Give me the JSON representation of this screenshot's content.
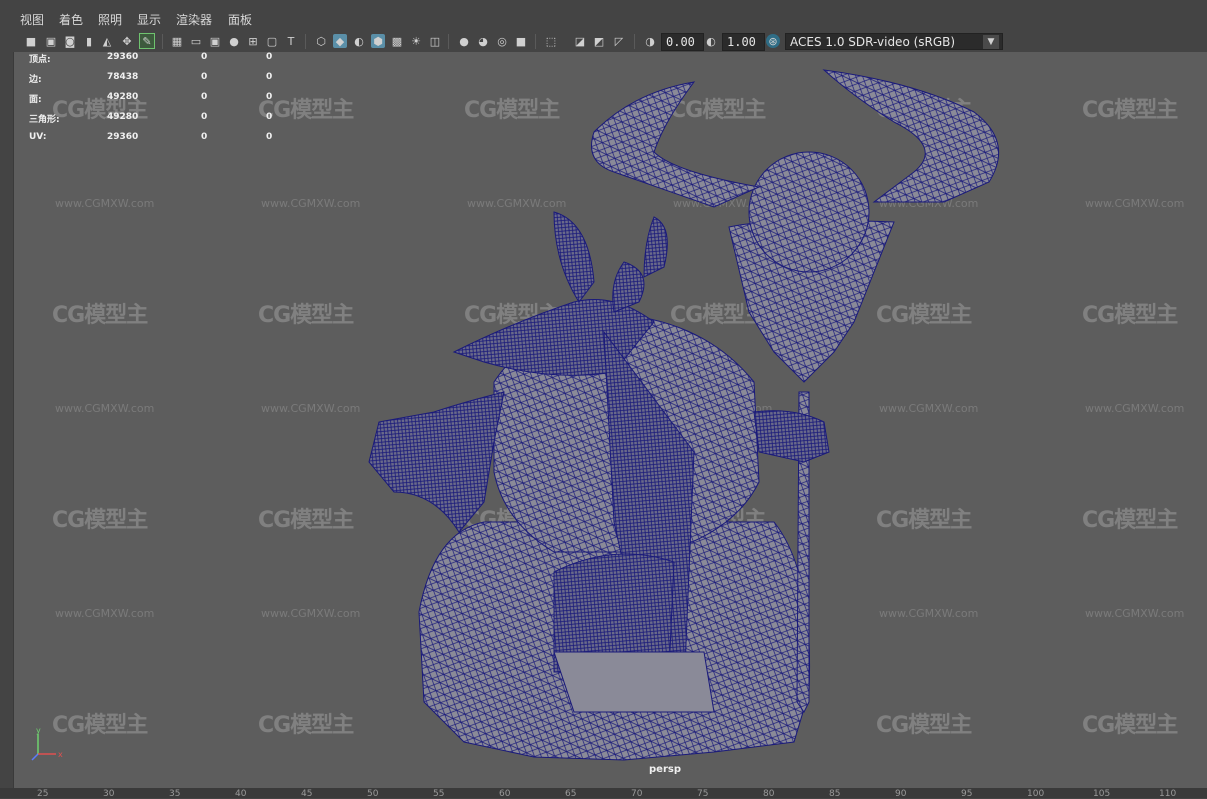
{
  "menu": [
    "视图",
    "着色",
    "照明",
    "显示",
    "渲染器",
    "面板"
  ],
  "toolbar": {
    "exposure_value": "0.00",
    "gamma_value": "1.00",
    "color_space": "ACES 1.0 SDR-video (sRGB)",
    "icons": [
      "select-camera-icon",
      "camera-attrs-icon",
      "bookmark-icon",
      "image-plane-icon",
      "2d-pan-icon",
      "grease-pencil-icon",
      "grid-icon",
      "film-gate-icon",
      "resolution-gate-icon",
      "gate-mask-icon",
      "field-chart-icon",
      "safe-action-icon",
      "safe-title-icon",
      "wireframe-icon",
      "smooth-shade-icon",
      "flat-shade-icon",
      "wireframe-on-shaded-icon",
      "textured-icon",
      "lighting-icon",
      "shadows-icon",
      "ambient-occlusion-icon",
      "motion-blur-icon",
      "anti-alias-icon",
      "depth-of-field-icon",
      "isolate-select-icon",
      "xray-icon",
      "xray-joints-icon",
      "backface-icon",
      "exposure-icon",
      "gamma-icon",
      "color-management-icon"
    ]
  },
  "hud": {
    "rows": [
      {
        "label": "顶点:",
        "total": "29360",
        "selected": "0",
        "uv": "0"
      },
      {
        "label": "边:",
        "total": "78438",
        "selected": "0",
        "uv": "0"
      },
      {
        "label": "面:",
        "total": "49280",
        "selected": "0",
        "uv": "0"
      },
      {
        "label": "三角形:",
        "total": "49280",
        "selected": "0",
        "uv": "0"
      },
      {
        "label": "UV:",
        "total": "29360",
        "selected": "0",
        "uv": "0"
      }
    ]
  },
  "watermark": {
    "logo": "CG模型主",
    "url": "www.CGMXW.com"
  },
  "camera_label": "persp",
  "axis": {
    "y": "y",
    "x": "x",
    "z": "z"
  },
  "ruler": [
    "25",
    "30",
    "35",
    "40",
    "45",
    "50",
    "55",
    "60",
    "65",
    "70",
    "75",
    "80",
    "85",
    "90",
    "95",
    "100",
    "105",
    "110"
  ],
  "colors": {
    "wireframe": "#1a1a7a",
    "mesh": "#8a8a98",
    "viewport_bg": "#5d5d5d"
  }
}
